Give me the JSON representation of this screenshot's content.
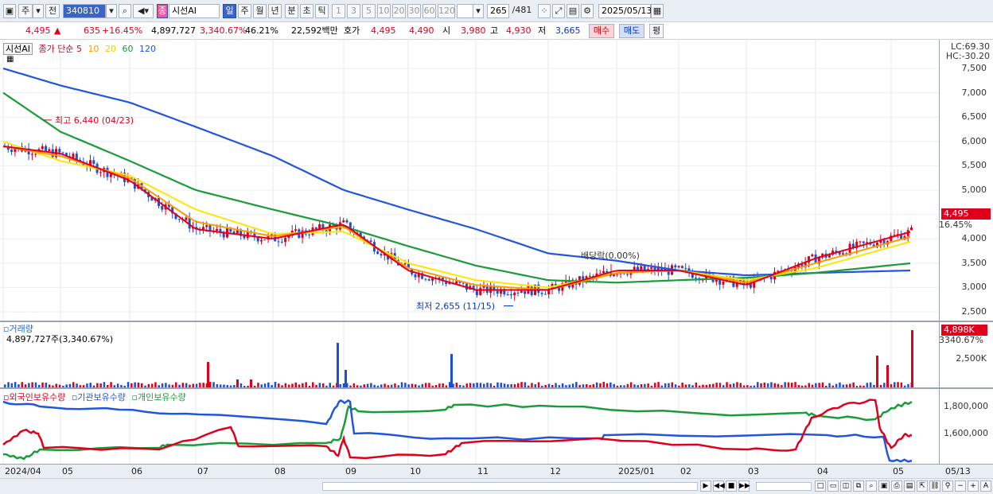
{
  "toolbar": {
    "period": "주",
    "prev": "전",
    "code": "340810",
    "stock_name": "시선AI",
    "day": "일",
    "week": "주",
    "month": "월",
    "year": "년",
    "minute": "분",
    "second": "초",
    "tick": "틱",
    "intervals": [
      "1",
      "3",
      "5",
      "10",
      "20",
      "30",
      "60",
      "120"
    ],
    "count": "265",
    "total": "/481",
    "date": "2025/05/13"
  },
  "quote": {
    "price": "4,495",
    "change": "635",
    "change_pct": "+16.45%",
    "volume": "4,897,727",
    "vol_ratio": "3,340.67%",
    "turnover": "46.21%",
    "amount": "22,592백만",
    "bid_label": "호가",
    "ask": "4,495",
    "bid": "4,490",
    "open_label": "시",
    "open": "3,980",
    "high_label": "고",
    "high": "4,930",
    "low_label": "저",
    "low": "3,665",
    "buy": "매수",
    "sell": "매도",
    "eval": "평"
  },
  "price_panel": {
    "legend": "종가 단순",
    "ma": [
      "5",
      "10",
      "20",
      "60",
      "120"
    ],
    "ma_colors": [
      "#e0001b",
      "#ff9900",
      "#ffe600",
      "#1a9c3a",
      "#2255dd"
    ],
    "stock": "시선AI",
    "lc": "LC:69.30",
    "hc": "HC:-30.20",
    "y_labels": [
      "7,500",
      "7,000",
      "6,500",
      "6,000",
      "5,500",
      "5,000",
      "4,500",
      "4,000",
      "3,500",
      "3,000",
      "2,500"
    ],
    "current_tag": "4,495",
    "current_pct": "16.45%",
    "high_note": "최고 6,440 (04/23)",
    "low_note": "최저 2,655 (11/15)",
    "dividend_note": "배당락(0.00%)"
  },
  "volume_panel": {
    "title": "거래량",
    "value": "4,897,727주(3,340.67%)",
    "y_label": "2,500K",
    "tag": "4,898K",
    "tag_pct": "3340.67%"
  },
  "holdings_panel": {
    "series": [
      "외국인보유수량",
      "기관보유수량",
      "개인보유수량"
    ],
    "colors": [
      "#e0001b",
      "#2255dd",
      "#1a9c3a"
    ],
    "y_labels": [
      "1,800,000",
      "1,600,000"
    ]
  },
  "x_labels": [
    "2024/04",
    "05",
    "06",
    "07",
    "08",
    "09",
    "10",
    "11",
    "12",
    "2025/01",
    "02",
    "03",
    "04",
    "05"
  ],
  "x_end": "05/13",
  "chart_data": {
    "type": "line",
    "y_unit": "KRW",
    "ylim": [
      2400,
      7700
    ],
    "x": [
      "2024/04",
      "2024/05",
      "2024/06",
      "2024/07",
      "2024/08",
      "2024/09",
      "2024/10",
      "2024/11",
      "2024/12",
      "2025/01",
      "2025/02",
      "2025/03",
      "2025/04",
      "2025/05"
    ],
    "series": [
      {
        "name": "5",
        "values": [
          5900,
          5750,
          5200,
          4200,
          4000,
          4300,
          3350,
          2950,
          2950,
          3350,
          3350,
          3050,
          3600,
          4150
        ]
      },
      {
        "name": "10",
        "values": [
          5900,
          5700,
          5250,
          4350,
          4050,
          4250,
          3400,
          3050,
          2950,
          3300,
          3350,
          3100,
          3500,
          4050
        ]
      },
      {
        "name": "20",
        "values": [
          6000,
          5600,
          5300,
          4600,
          4100,
          4150,
          3500,
          3150,
          3000,
          3300,
          3350,
          3150,
          3400,
          3950
        ]
      },
      {
        "name": "60",
        "values": [
          7000,
          6200,
          5600,
          5000,
          4600,
          4250,
          3850,
          3450,
          3150,
          3100,
          3150,
          3200,
          3300,
          3500
        ]
      },
      {
        "name": "120",
        "values": [
          7500,
          7150,
          6800,
          6300,
          5700,
          5000,
          4600,
          4200,
          3700,
          3550,
          3350,
          3250,
          3300,
          3350
        ]
      }
    ],
    "high": {
      "date": "04/23",
      "value": 6440
    },
    "low": {
      "date": "11/15",
      "value": 2655
    },
    "last": 4495
  }
}
